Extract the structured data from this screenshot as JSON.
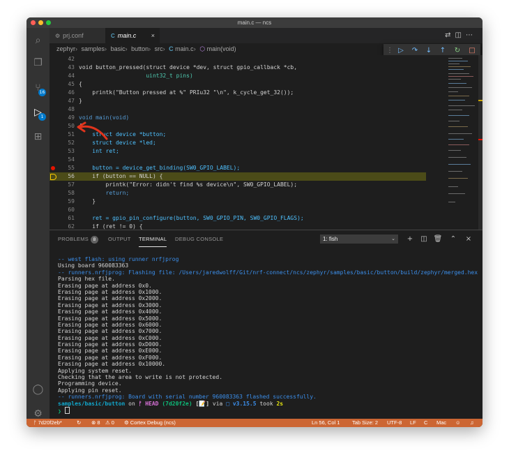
{
  "window": {
    "title": "main.c — ncs"
  },
  "tabs": [
    {
      "icon": "⚙",
      "label": "prj.conf"
    },
    {
      "icon": "C",
      "label": "main.c",
      "close": "×"
    }
  ],
  "breadcrumb": [
    "zephyr",
    "samples",
    "basic",
    "button",
    "src",
    "main.c",
    "main(void)"
  ],
  "breadcrumb_c_icon": "C",
  "activity_badges": {
    "scm": "16",
    "debug": "1"
  },
  "editor_lines": [
    {
      "num": "42",
      "code": ""
    },
    {
      "num": "43",
      "code": "void button_pressed(struct device *dev, struct gpio_callback *cb,"
    },
    {
      "num": "44",
      "code": "                    uint32_t pins)"
    },
    {
      "num": "45",
      "code": "{"
    },
    {
      "num": "46",
      "code": "    printk(\"Button pressed at %\" PRIu32 \"\\n\", k_cycle_get_32());"
    },
    {
      "num": "47",
      "code": "}"
    },
    {
      "num": "48",
      "code": ""
    },
    {
      "num": "49",
      "code": "void main(void)"
    },
    {
      "num": "50",
      "code": "{"
    },
    {
      "num": "51",
      "code": "    struct device *button;"
    },
    {
      "num": "52",
      "code": "    struct device *led;"
    },
    {
      "num": "53",
      "code": "    int ret;"
    },
    {
      "num": "54",
      "code": ""
    },
    {
      "num": "55",
      "code": "    button = device_get_binding(SW0_GPIO_LABEL);"
    },
    {
      "num": "56",
      "code": "    if (button == NULL) {"
    },
    {
      "num": "57",
      "code": "        printk(\"Error: didn't find %s device\\n\", SW0_GPIO_LABEL);"
    },
    {
      "num": "58",
      "code": "        return;"
    },
    {
      "num": "59",
      "code": "    }"
    },
    {
      "num": "60",
      "code": ""
    },
    {
      "num": "61",
      "code": "    ret = gpio_pin_configure(button, SW0_GPIO_PIN, SW0_GPIO_FLAGS);"
    },
    {
      "num": "62",
      "code": "    if (ret != 0) {"
    }
  ],
  "panel": {
    "tabs": [
      "PROBLEMS",
      "OUTPUT",
      "TERMINAL",
      "DEBUG CONSOLE"
    ],
    "problems_count": "8",
    "active_tab": "TERMINAL",
    "terminal_select": "1: fish"
  },
  "terminal_lines": [
    "-- west flash: using runner nrfjprog",
    "Using board 960083363",
    "-- runners.nrfjprog: Flashing file: /Users/jaredwolff/Git/nrf-connect/ncs/zephyr/samples/basic/button/build/zephyr/merged.hex",
    "Parsing hex file.",
    "Erasing page at address 0x0.",
    "Erasing page at address 0x1000.",
    "Erasing page at address 0x2000.",
    "Erasing page at address 0x3000.",
    "Erasing page at address 0x4000.",
    "Erasing page at address 0x5000.",
    "Erasing page at address 0x6000.",
    "Erasing page at address 0x7000.",
    "Erasing page at address 0xC000.",
    "Erasing page at address 0xD000.",
    "Erasing page at address 0xE000.",
    "Erasing page at address 0xF000.",
    "Erasing page at address 0x10000.",
    "Applying system reset.",
    "Checking that the area to write is not protected.",
    "Programming device.",
    "Applying pin reset.",
    "-- runners.nrfjprog: Board with serial number 960083363 flashed successfully."
  ],
  "prompt": {
    "path": "samples/basic/button",
    "on": " on ",
    "branch": "ᚠ HEAD",
    "hash": "(7d20f2e)",
    "flag": "[📝]",
    "via": " via ",
    "version": "□ v3.15.5",
    "took": " took ",
    "duration": "2s",
    "caret": "❯"
  },
  "status": {
    "branch": "ᚠ 7d20f2eb*",
    "sync": "↻",
    "errors": "⊗ 8",
    "warnings": "⚠ 0",
    "debug": "⚙ Cortex Debug (ncs)",
    "position": "Ln 56, Col 1",
    "tabsize": "Tab Size: 2",
    "encoding": "UTF-8",
    "eol": "LF",
    "language": "C",
    "platform": "Mac"
  },
  "colors": {
    "status_bar": "#cc6633",
    "accent": "#007acc",
    "callout_arrow": "#e0341c"
  }
}
